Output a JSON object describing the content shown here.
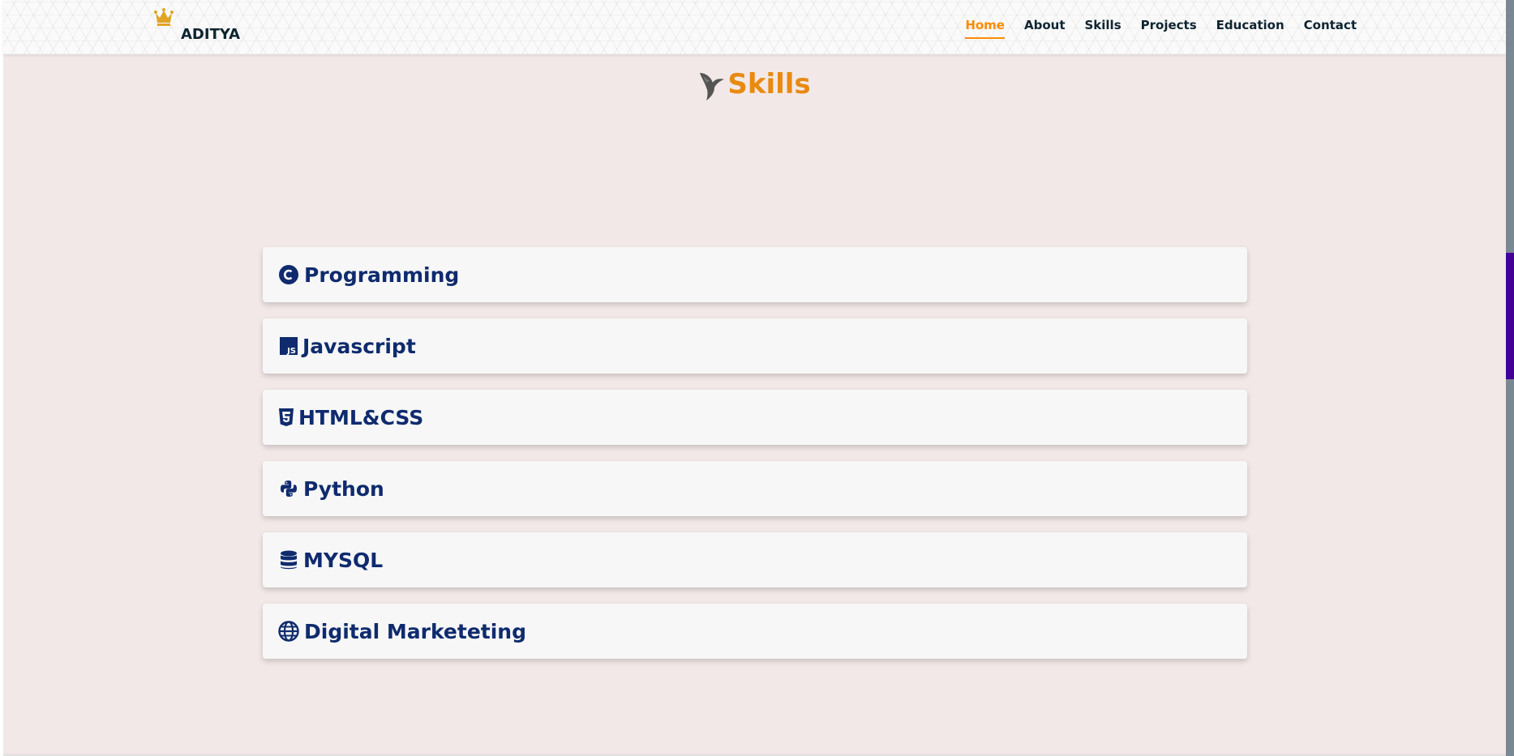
{
  "brand": {
    "name": "ADITYA",
    "icon": "crown-icon"
  },
  "nav": {
    "items": [
      {
        "label": "Home",
        "active": true
      },
      {
        "label": "About",
        "active": false
      },
      {
        "label": "Skills",
        "active": false
      },
      {
        "label": "Projects",
        "active": false
      },
      {
        "label": "Education",
        "active": false
      },
      {
        "label": "Contact",
        "active": false
      }
    ]
  },
  "section": {
    "title": "Skills",
    "icon": "bird-icon"
  },
  "skills": [
    {
      "label": "Programming",
      "icon": "c-language-icon"
    },
    {
      "label": "Javascript",
      "icon": "javascript-icon"
    },
    {
      "label": "HTML&CSS",
      "icon": "html5-icon"
    },
    {
      "label": "Python",
      "icon": "python-icon"
    },
    {
      "label": "MYSQL",
      "icon": "database-icon"
    },
    {
      "label": "Digital Marketeting",
      "icon": "globe-icon"
    }
  ],
  "colors": {
    "accent": "#fc8c05",
    "title": "#e88a12",
    "skill_text": "#0f2b6e",
    "background": "#f2e8e7",
    "scrollbar_thumb": "#420097"
  }
}
